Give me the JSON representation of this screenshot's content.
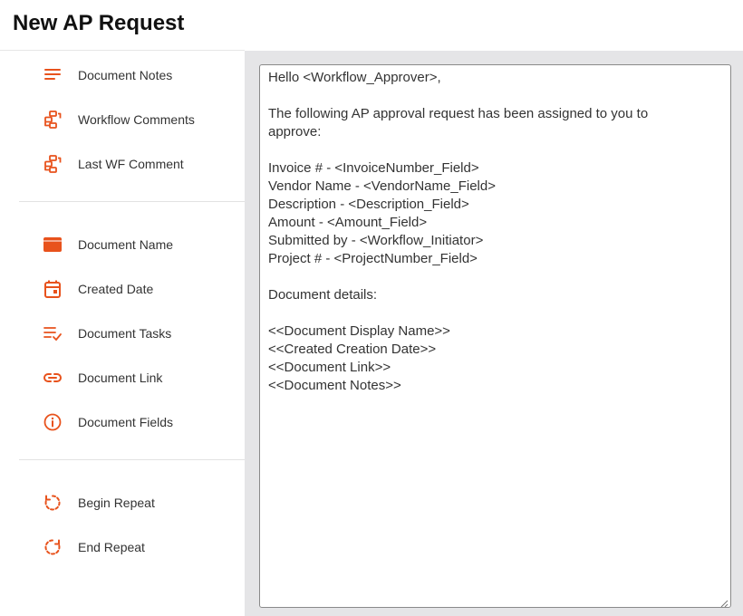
{
  "page": {
    "title": "New AP Request"
  },
  "colors": {
    "accent": "#e8521c",
    "panel_bg": "#e5e5e7"
  },
  "sidebar": {
    "groups": [
      [
        {
          "label": "Document Notes",
          "icon": "notes-lines-icon"
        },
        {
          "label": "Workflow Comments",
          "icon": "workflow-comment-icon"
        },
        {
          "label": "Last WF Comment",
          "icon": "workflow-comment-icon"
        }
      ],
      [
        {
          "label": "Document Name",
          "icon": "document-card-icon"
        },
        {
          "label": "Created Date",
          "icon": "calendar-icon"
        },
        {
          "label": "Document Tasks",
          "icon": "task-list-check-icon"
        },
        {
          "label": "Document Link",
          "icon": "link-icon"
        },
        {
          "label": "Document Fields",
          "icon": "info-circle-icon"
        }
      ],
      [
        {
          "label": "Begin Repeat",
          "icon": "repeat-begin-icon"
        },
        {
          "label": "End Repeat",
          "icon": "repeat-end-icon"
        }
      ]
    ]
  },
  "editor": {
    "lines": [
      "Hello <Workflow_Approver>,",
      "",
      "The following AP approval request has been assigned to you to",
      "approve:",
      "",
      "Invoice # - <InvoiceNumber_Field>",
      "Vendor Name - <VendorName_Field>",
      "Description - <Description_Field>",
      "Amount - <Amount_Field>",
      "Submitted by - <Workflow_Initiator>",
      "Project # - <ProjectNumber_Field>",
      "",
      "Document details:",
      "",
      "<<Document Display Name>>",
      "<<Created Creation Date>>",
      "<<Document Link>>",
      "<<Document Notes>>"
    ]
  }
}
